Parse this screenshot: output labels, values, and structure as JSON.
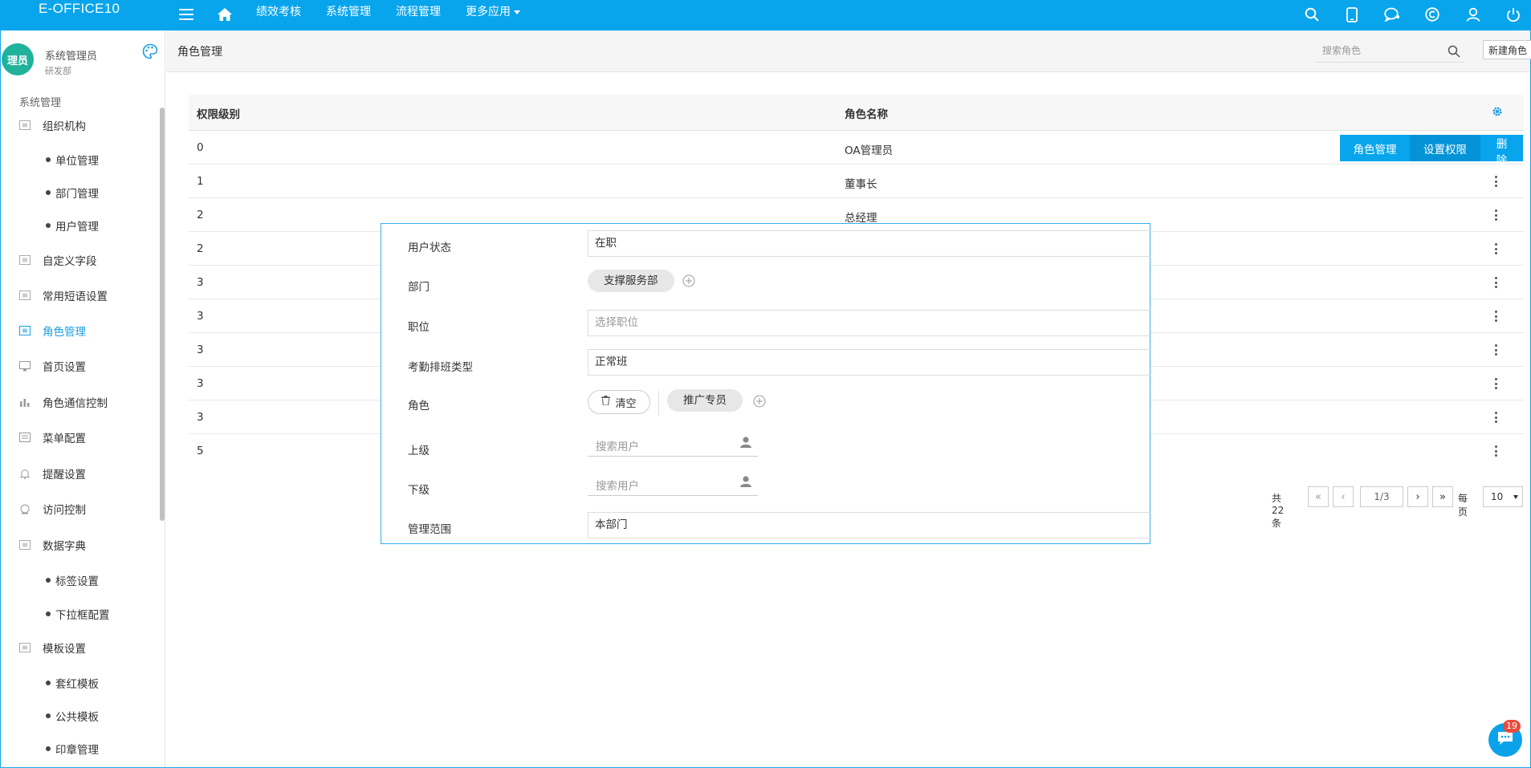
{
  "app": {
    "brand": "E-OFFICE10"
  },
  "topnav": {
    "items": [
      "绩效考核",
      "系统管理",
      "流程管理"
    ],
    "more": "更多应用"
  },
  "icons": {
    "menu": "hamburger-icon",
    "home": "home-icon",
    "search": "search-icon",
    "mobile": "mobile-icon",
    "chat": "chat-icon",
    "copyright": "copyright-icon",
    "user": "user-icon",
    "power": "power-icon",
    "palette": "palette-icon",
    "gear": "gear-icon"
  },
  "colors": {
    "primary": "#08a5ec",
    "primary_dark": "#0393d6",
    "active_menu": "#1a9de3",
    "avatar": "#20b29b",
    "badge": "#e84c3d"
  },
  "user": {
    "avatar_text": "理员",
    "name": "系统管理员",
    "dept": "研发部"
  },
  "sidebar": {
    "section": "系统管理",
    "items": [
      {
        "label": "组织机构"
      },
      {
        "label": "单位管理"
      },
      {
        "label": "部门管理"
      },
      {
        "label": "用户管理"
      },
      {
        "label": "自定义字段"
      },
      {
        "label": "常用短语设置"
      },
      {
        "label": "角色管理"
      },
      {
        "label": "首页设置"
      },
      {
        "label": "角色通信控制"
      },
      {
        "label": "菜单配置"
      },
      {
        "label": "提醒设置"
      },
      {
        "label": "访问控制"
      },
      {
        "label": "数据字典"
      },
      {
        "label": "标签设置"
      },
      {
        "label": "下拉框配置"
      },
      {
        "label": "模板设置"
      },
      {
        "label": "套红模板"
      },
      {
        "label": "公共模板"
      },
      {
        "label": "印章管理"
      }
    ]
  },
  "header": {
    "title": "角色管理",
    "search_placeholder": "搜索角色",
    "new_button": "新建角色"
  },
  "table": {
    "columns": [
      "权限级别",
      "角色名称"
    ],
    "rows": [
      {
        "level": "0",
        "name": "OA管理员"
      },
      {
        "level": "1",
        "name": "董事长"
      },
      {
        "level": "2",
        "name": "总经理"
      },
      {
        "level": "2",
        "name": ""
      },
      {
        "level": "3",
        "name": ""
      },
      {
        "level": "3",
        "name": ""
      },
      {
        "level": "3",
        "name": ""
      },
      {
        "level": "3",
        "name": ""
      },
      {
        "level": "3",
        "name": ""
      },
      {
        "level": "5",
        "name": ""
      }
    ],
    "row_actions": [
      "角色管理",
      "设置权限",
      "删除"
    ]
  },
  "pager": {
    "total": "共22条",
    "page": "1/3",
    "per_page_label": "每页",
    "per_page": "10"
  },
  "form": {
    "status_label": "用户状态",
    "status_value": "在职",
    "dept_label": "部门",
    "dept_tag": "支撑服务部",
    "position_label": "职位",
    "position_placeholder": "选择职位",
    "attendance_label": "考勤排班类型",
    "attendance_value": "正常班",
    "role_label": "角色",
    "clear_label": "清空",
    "role_tag": "推广专员",
    "superior_label": "上级",
    "subordinate_label": "下级",
    "user_search_placeholder": "搜索用户",
    "scope_label": "管理范围",
    "scope_value": "本部门"
  },
  "chat": {
    "badge": "19"
  }
}
